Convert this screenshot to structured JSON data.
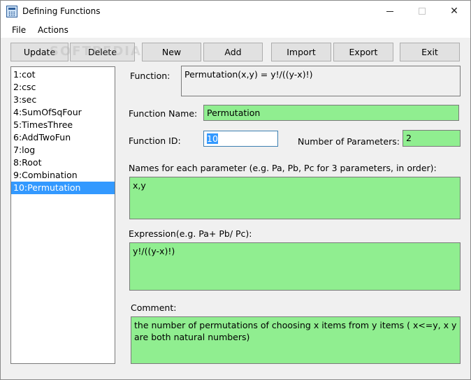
{
  "window": {
    "title": "Defining Functions",
    "minimize_glyph": "",
    "maximize_glyph": "",
    "close_glyph": "✕"
  },
  "menu": {
    "file": "File",
    "actions": "Actions"
  },
  "toolbar": {
    "update": "Update",
    "delete": "Delete",
    "new": "New",
    "add": "Add",
    "import": "Import",
    "export": "Export",
    "exit": "Exit"
  },
  "watermark": "SOFTPEDIA",
  "functions_list": {
    "items": [
      "1:cot",
      "2:csc",
      "3:sec",
      "4:SumOfSqFour",
      "5:TimesThree",
      "6:AddTwoFun",
      "7:log",
      "8:Root",
      "9:Combination",
      "10:Permutation"
    ],
    "selected_index": 9
  },
  "form": {
    "function_label": "Function:",
    "function_value": "Permutation(x,y) = y!/((y-x)!)",
    "name_label": "Function Name:",
    "name_value": "Permutation",
    "id_label": "Function ID:",
    "id_value": "10",
    "params_count_label": "Number of Parameters:",
    "params_count_value": "2",
    "param_names_label": "Names for each parameter (e.g. Pa, Pb, Pc for 3 parameters, in order):",
    "param_names_value": "x,y",
    "expression_label": "Expression(e.g. Pa+ Pb/ Pc):",
    "expression_value": "y!/((y-x)!)",
    "comment_label": "Comment:",
    "comment_value": "the number of permutations of choosing x items from y items ( x<=y, x y are both natural numbers)"
  },
  "colors": {
    "field_green": "#90ee90",
    "selection_blue": "#3399ff",
    "window_bg": "#f0f0f0"
  }
}
